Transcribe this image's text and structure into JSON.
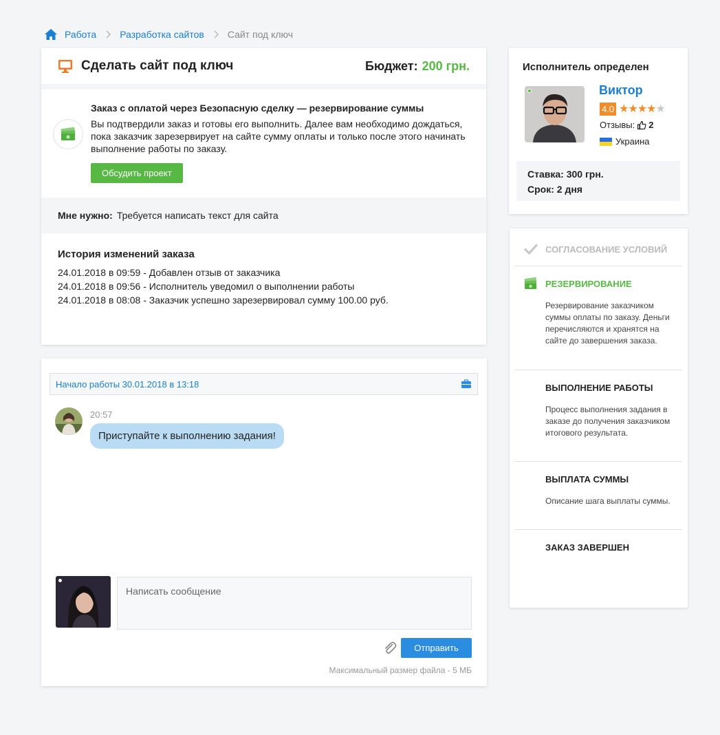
{
  "breadcrumbs": [
    {
      "label": "Работа"
    },
    {
      "label": "Разработка сайтов"
    },
    {
      "label": "Сайт под ключ"
    }
  ],
  "order": {
    "title": "Сделать сайт под ключ",
    "budget_label": "Бюджет:",
    "budget_value": "200 грн.",
    "deal_title": "Заказ с оплатой через Безопасную сделку — резервирование суммы",
    "deal_text": "Вы подтвердили заказ и готовы его выполнить. Далее вам необходимо дождаться, пока заказчик зарезервирует на сайте сумму оплаты и только после этого начинать выполнение работы по заказу.",
    "discuss_button": "Обсудить проект",
    "need_label": "Мне нужно:",
    "need_text": "Требуется написать текст для сайта",
    "history_title": "История изменений заказа",
    "history": [
      "24.01.2018 в 09:59 - Добавлен отзыв от заказчика",
      "24.01.2018 в 09:56 - Исполнитель уведомил о выполнении работы",
      "24.01.2018 в 08:08 - Заказчик успешно зарезервировал сумму 100.00 руб."
    ]
  },
  "chat": {
    "start_label": "Начало работы 30.01.2018 в 13:18",
    "message_time": "20:57",
    "message_text": "Приступайте к выполнению задания!",
    "compose_placeholder": "Написать сообщение",
    "send_button": "Отправить",
    "max_size": "Максимальный размер файла - 5 МБ"
  },
  "performer": {
    "heading": "Исполнитель определен",
    "name": "Виктор",
    "rating": "4.0",
    "stars_filled": 4,
    "stars_total": 5,
    "reviews_label": "Отзывы:",
    "reviews_count": "2",
    "country": "Украина",
    "rate": "Ставка: 300 грн.",
    "term": "Срок: 2 дня"
  },
  "steps": [
    {
      "title": "СОГЛАСОВАНИЕ УСЛОВИЙ",
      "state": "done",
      "desc": ""
    },
    {
      "title": "РЕЗЕРВИРОВАНИЕ",
      "state": "active",
      "desc": "Резервирование заказчиком суммы оплаты по заказу. Деньги перечисляются и хранятся на сайте до завершения заказа."
    },
    {
      "title": "ВЫПОЛНЕНИЕ РАБОТЫ",
      "state": "todo",
      "desc": "Процесс выполнения задания в заказе до получения заказчиком итогового результата."
    },
    {
      "title": "ВЫПЛАТА СУММЫ",
      "state": "todo",
      "desc": "Описание шага выплаты суммы."
    },
    {
      "title": "ЗАКАЗ ЗАВЕРШЕН",
      "state": "todo",
      "desc": ""
    }
  ],
  "colors": {
    "accent_blue": "#1a7fd0",
    "accent_green": "#57b843",
    "rating_orange": "#f28c28",
    "bubble": "#b9dbf4"
  }
}
